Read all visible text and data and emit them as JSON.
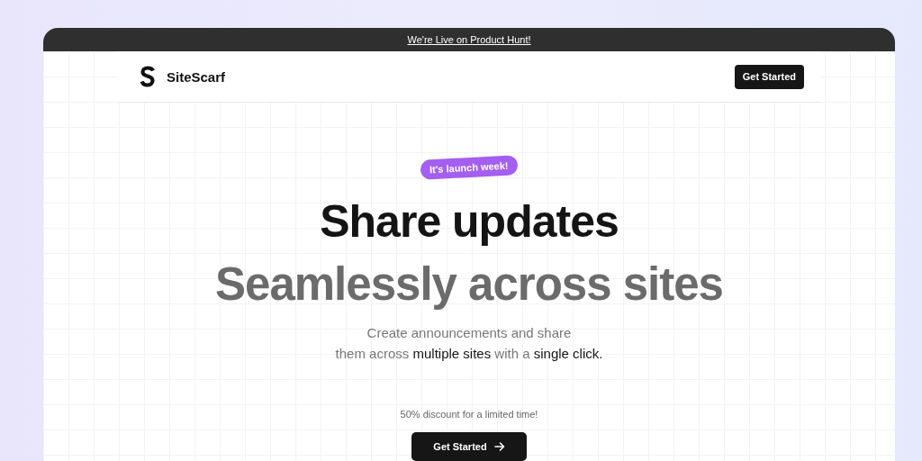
{
  "banner": {
    "link": "We're Live on Product Hunt!"
  },
  "nav": {
    "brand": "SiteScarf",
    "button": "Get Started"
  },
  "hero": {
    "badge": "It's launch week!",
    "title": "Share updates",
    "subtitle_title": "Seamlessly across sites",
    "description": [
      {
        "lines": [
          {
            "text": "Create announcements and share",
            "emphasis": false
          }
        ]
      },
      {
        "lines": [
          {
            "text": "them across ",
            "emphasis": false
          },
          {
            "text": "multiple sites",
            "emphasis": true
          },
          {
            "text": " with a ",
            "emphasis": false
          },
          {
            "text": "single click.",
            "emphasis": true
          }
        ]
      }
    ],
    "offer": "50% discount for a limited time!",
    "cta": "Get Started"
  }
}
